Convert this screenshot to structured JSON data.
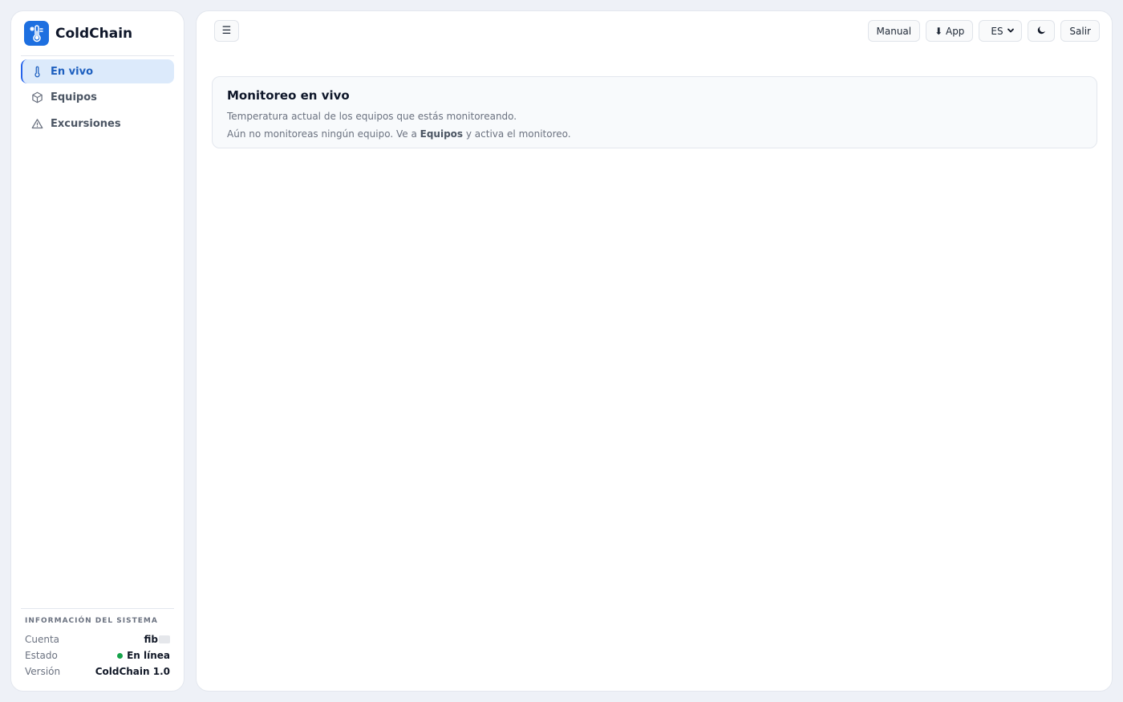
{
  "brand": {
    "name": "ColdChain",
    "logo_icon": "thermometer-snowflake-icon",
    "accent": "#1d6fe0"
  },
  "nav": {
    "items": [
      {
        "label": "En vivo",
        "icon": "thermometer-icon",
        "active": true
      },
      {
        "label": "Equipos",
        "icon": "box-icon",
        "active": false
      },
      {
        "label": "Excursiones",
        "icon": "warning-triangle-icon",
        "active": false
      }
    ]
  },
  "system": {
    "title": "Información del sistema",
    "account_label": "Cuenta",
    "account_value": "fib",
    "status_label": "Estado",
    "status_value": "En línea",
    "status_color": "#16a34a",
    "version_label": "Versión",
    "version_value": "ColdChain 1.0"
  },
  "topbar": {
    "menu_glyph": "☰",
    "manual_label": "Manual",
    "app_label": "⬇ App",
    "lang_value": "ES",
    "logout_label": "Salir"
  },
  "monitor": {
    "title": "Monitoreo en vivo",
    "subtitle": "Temperatura actual de los equipos que estás monitoreando.",
    "empty_prefix": "Aún no monitoreas ningún equipo. Ve a ",
    "empty_link": "Equipos",
    "empty_suffix": " y activa el monitoreo."
  }
}
